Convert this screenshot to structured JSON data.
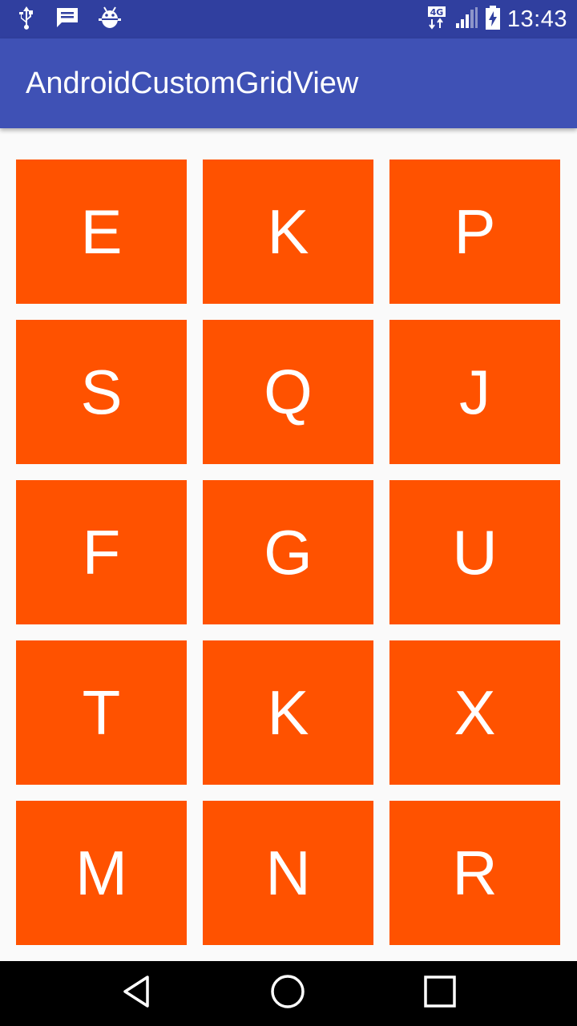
{
  "status_bar": {
    "time": "13:43",
    "network_label": "4G",
    "icons": [
      "usb-icon",
      "message-icon",
      "android-debug-icon",
      "network-4g-icon",
      "signal-icon",
      "battery-charging-icon"
    ]
  },
  "app_bar": {
    "title": "AndroidCustomGridView"
  },
  "grid": {
    "items": [
      {
        "letter": "E"
      },
      {
        "letter": "K"
      },
      {
        "letter": "P"
      },
      {
        "letter": "S"
      },
      {
        "letter": "Q"
      },
      {
        "letter": "J"
      },
      {
        "letter": "F"
      },
      {
        "letter": "G"
      },
      {
        "letter": "U"
      },
      {
        "letter": "T"
      },
      {
        "letter": "K"
      },
      {
        "letter": "X"
      },
      {
        "letter": "M"
      },
      {
        "letter": "N"
      },
      {
        "letter": "R"
      }
    ]
  },
  "nav_bar": {
    "buttons": [
      "back-icon",
      "home-icon",
      "recents-icon"
    ]
  },
  "colors": {
    "status_bar": "#303f9f",
    "app_bar": "#3f51b5",
    "tile": "#ff5200",
    "background": "#fafafa"
  }
}
